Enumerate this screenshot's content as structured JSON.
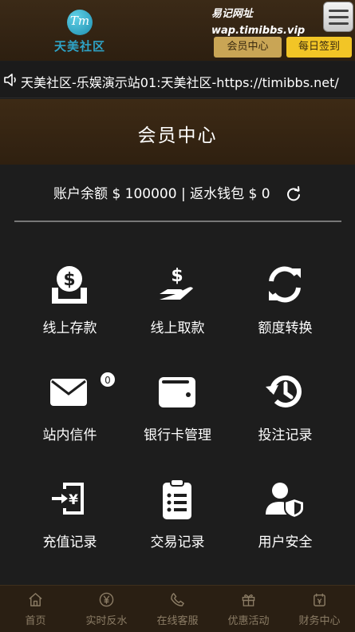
{
  "header": {
    "logo_badge": "Tm",
    "logo_text": "天美社区",
    "promo_line1": "易记网址",
    "promo_line2": "wap.timibbs.vip",
    "member_center_button": "会员中心",
    "daily_signin_button": "每日签到"
  },
  "marquee": {
    "text": "天美社区-乐娱演示站01:天美社区-https://timibbs.net/"
  },
  "page": {
    "title": "会员中心"
  },
  "balance": {
    "account_label": "账户余额",
    "account_value": "$ 100000",
    "separator": "|",
    "rebate_label": "返水钱包",
    "rebate_value": "$ 0"
  },
  "menu": [
    {
      "label": "线上存款",
      "icon": "deposit-icon"
    },
    {
      "label": "线上取款",
      "icon": "withdraw-icon"
    },
    {
      "label": "额度转换",
      "icon": "transfer-icon"
    },
    {
      "label": "站内信件",
      "icon": "mail-icon",
      "badge": "0"
    },
    {
      "label": "银行卡管理",
      "icon": "wallet-icon"
    },
    {
      "label": "投注记录",
      "icon": "history-icon"
    },
    {
      "label": "充值记录",
      "icon": "recharge-record-icon"
    },
    {
      "label": "交易记录",
      "icon": "clipboard-icon"
    },
    {
      "label": "用户安全",
      "icon": "user-shield-icon"
    }
  ],
  "tabbar": [
    {
      "label": "首页",
      "icon": "home-icon"
    },
    {
      "label": "实时反水",
      "icon": "yen-icon"
    },
    {
      "label": "在线客服",
      "icon": "phone-icon"
    },
    {
      "label": "优惠活动",
      "icon": "gift-icon"
    },
    {
      "label": "财务中心",
      "icon": "finance-icon"
    }
  ],
  "colors": {
    "header_bg": "#3b2a17",
    "body_bg": "#1d1d1d",
    "member_btn": "#c9a555",
    "signin_btn": "#f2c526",
    "tab_text": "#8b7c65"
  }
}
